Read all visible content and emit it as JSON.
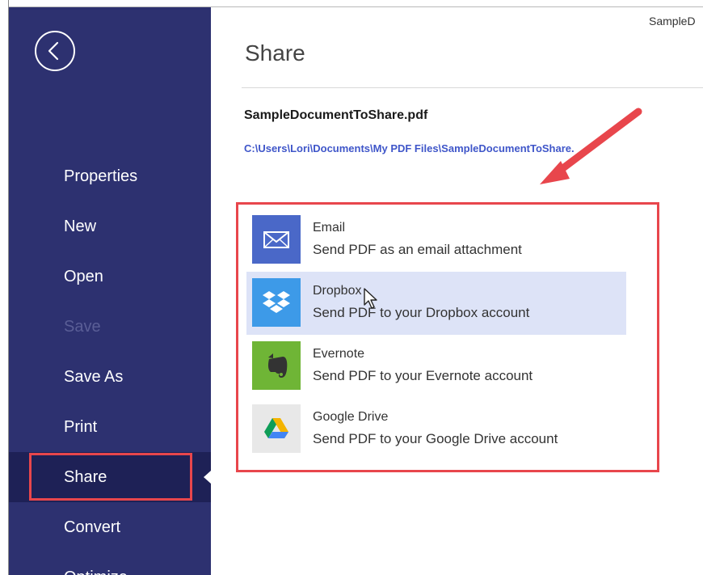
{
  "header": {
    "doc_title": "SampleD"
  },
  "sidebar": {
    "back_label": "Back",
    "items": [
      {
        "label": "Properties",
        "state": "normal"
      },
      {
        "label": "New",
        "state": "normal"
      },
      {
        "label": "Open",
        "state": "normal"
      },
      {
        "label": "Save",
        "state": "disabled"
      },
      {
        "label": "Save As",
        "state": "normal"
      },
      {
        "label": "Print",
        "state": "normal"
      },
      {
        "label": "Share",
        "state": "active"
      },
      {
        "label": "Convert",
        "state": "normal"
      },
      {
        "label": "Optimize",
        "state": "normal"
      }
    ]
  },
  "main": {
    "title": "Share",
    "file_name": "SampleDocumentToShare.pdf",
    "file_path": "C:\\Users\\Lori\\Documents\\My PDF Files\\SampleDocumentToShare.",
    "share_options": [
      {
        "name": "Email",
        "description": "Send PDF as an email attachment",
        "icon": "email-icon"
      },
      {
        "name": "Dropbox",
        "description": "Send PDF to your Dropbox account",
        "icon": "dropbox-icon"
      },
      {
        "name": "Evernote",
        "description": "Send PDF to your Evernote account",
        "icon": "evernote-icon"
      },
      {
        "name": "Google Drive",
        "description": "Send PDF to your Google Drive account",
        "icon": "google-drive-icon"
      }
    ]
  },
  "colors": {
    "sidebar_bg": "#2d3170",
    "sidebar_active_bg": "#1e2156",
    "highlight_red": "#e8464c",
    "link_blue": "#3f56c9",
    "hover_bg": "#dde3f7",
    "email_blue": "#4a68c8",
    "dropbox_blue": "#3d9ae8",
    "evernote_green": "#6fb536",
    "gdrive_bg": "#e8e8e8"
  }
}
